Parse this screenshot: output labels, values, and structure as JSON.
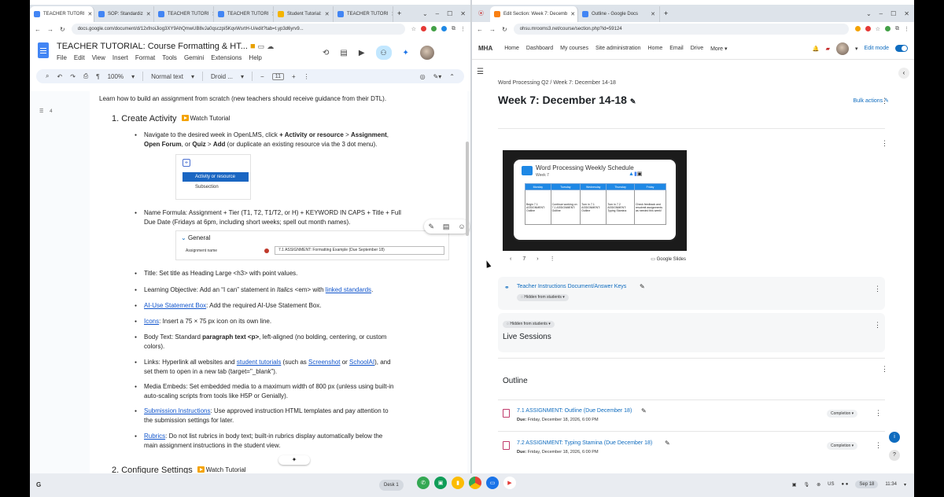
{
  "left_browser": {
    "tabs": [
      {
        "label": "TEACHER TUTORI",
        "color": "#4285f4"
      },
      {
        "label": "SOP: Standardiz",
        "color": "#4285f4"
      },
      {
        "label": "TEACHER TUTORI",
        "color": "#4285f4"
      },
      {
        "label": "TEACHER TUTORI",
        "color": "#4285f4"
      },
      {
        "label": "Student Tutorial:",
        "color": "#f4b400"
      },
      {
        "label": "TEACHER TUTORI",
        "color": "#4285f4"
      }
    ],
    "url": "docs.google.com/document/d/12xfnoiJiog3XY9AhQmwUB8vJa0qsczpi5KqvWsrtH-U/edit?tab=t.yp3d6yrv9..."
  },
  "docs": {
    "title": "TEACHER TUTORIAL: Course Formatting & HT...",
    "menu": [
      "File",
      "Edit",
      "View",
      "Insert",
      "Format",
      "Tools",
      "Gemini",
      "Extensions",
      "Help"
    ],
    "zoom": "100%",
    "style": "Normal text",
    "font": "Droid ...",
    "size": "11",
    "outline_count": "4",
    "intro": "Learn how to build an assignment from scratch (new teachers should receive guidance from their DTL).",
    "section1": "1.  Create Activity",
    "watch": "Watch Tutorial",
    "b1_line1_a": "Navigate to the desired week in OpenLMS, click ",
    "b1_bold1": "+ Activity or resource",
    "b1_gt": " > ",
    "b1_bold2": "Assignment",
    "b1_comma": ",",
    "b1_line2_bold1": "Open Forum",
    "b1_line2_or": ", or ",
    "b1_line2_bold2": "Quiz",
    "b1_line2_gt": " > ",
    "b1_line2_bold3": "Add",
    "b1_line2_rest": " (or duplicate an existing resource via the 3 dot menu).",
    "mini_act": "Activity or resource",
    "mini_sub": "Subsection",
    "b2_line1": "Name Formula: Assignment + Tier (T1, T2, T1/T2, or H) + KEYWORD IN CAPS + Title + Full",
    "b2_line2": "Due Date (Fridays at 6pm, including short weeks; spell out month names).",
    "general": "General",
    "assign_name": "Assignment name",
    "field_val": "7.1 ASSIGNMENT: Formatting Example (Due September 18)",
    "b3": "Title: Set title as Heading Large <h3> with point values.",
    "b4_a": "Learning Objective: Add an “I can” statement in ",
    "b4_i": "Italics",
    "b4_b": " <em> with ",
    "b4_link": "linked standards",
    "b4_c": ".",
    "b5_link": "AI-Use Statement Box",
    "b5_rest": ": Add the required AI-Use Statement Box.",
    "b6_link": "Icons",
    "b6_rest": ": Insert a 75 × 75 px icon on its own line.",
    "b7_a": "Body Text: Standard ",
    "b7_b": "paragraph text <p>",
    "b7_c": ", left-aligned (no bolding, centering, or custom",
    "b7_d": "colors).",
    "b8_a": "Links: Hyperlink all websites and ",
    "b8_l1": "student tutorials",
    "b8_b": " (such as ",
    "b8_l2": "Screenshot",
    "b8_or": " or ",
    "b8_l3": "SchoolAI",
    "b8_c": "), and",
    "b8_d": "set them to open in a new tab (target=\"_blank\").",
    "b9_a": "Media Embeds: Set embedded media to a maximum width of 800 px (unless using built-in",
    "b9_b": "auto-scaling scripts from tools like H5P or Genially).",
    "b10_link": "Submission Instructions",
    "b10_a": ": Use approved instruction HTML templates and pay attention to",
    "b10_b": "the submission settings for later.",
    "b11_link": "Rubrics",
    "b11_a": ": Do not list rubrics in body text; built-in rubrics display automatically below the",
    "b11_b": "main assignment instructions in the student view.",
    "section2": "2.  Configure Settings"
  },
  "right_browser": {
    "tabs": [
      {
        "label": "Edit Section: Week 7: Decemb",
        "color": "#f98012"
      },
      {
        "label": "Outline - Google Docs",
        "color": "#4285f4"
      }
    ],
    "url": "ohsu.mrooms3.net/course/section.php?id=59124"
  },
  "moodle": {
    "brand": "MHA",
    "nav": [
      "Home",
      "Dashboard",
      "My courses",
      "Site administration",
      "Home",
      "Email",
      "Drive",
      "More"
    ],
    "edit_mode": "Edit mode",
    "crumb_course": "Word Processing Q2",
    "crumb_sep": "/",
    "crumb_week": "Week 7: December 14-18",
    "title": "Week 7: December 14-18",
    "bulk": "Bulk actions",
    "slide_title": "Word Processing Weekly Schedule",
    "slide_week": "Week 7",
    "slide_days": [
      "Monday",
      "Tuesday",
      "Wednesday",
      "Thursday",
      "Friday"
    ],
    "slide_cells": [
      "Begin 7.1 ASSIGNMENT: Outline",
      "Continue working on 7.1 ASSIGNMENT: Outline",
      "Turn in 7.1 ASSIGNMENT: Outline",
      "Turn in 7.2 ASSIGNMENT: Typing Stamina",
      "Check feedback and resubmit assignments as needed this week!"
    ],
    "slide_page": "7",
    "slides_label": "Google Slides",
    "teacher_link": "Teacher Instructions Document/Answer Keys",
    "hidden": "Hidden from students",
    "live": "Live Sessions",
    "outline": "Outline",
    "a1_title": "7.1 ASSIGNMENT: Outline (Due December 18)",
    "a1_due_b": "Due:",
    "a1_due": " Friday, December 18, 2026, 6:00 PM",
    "a2_title": "7.2 ASSIGNMENT: Typing Stamina (Due December 18)",
    "a2_due_b": "Due:",
    "a2_due": " Friday, December 18, 2026, 6:00 PM",
    "completion": "Completion"
  },
  "shelf": {
    "launcher": "G",
    "desk": "Desk 1",
    "lang": "US",
    "date": "Sep 18",
    "time": "11:34"
  }
}
